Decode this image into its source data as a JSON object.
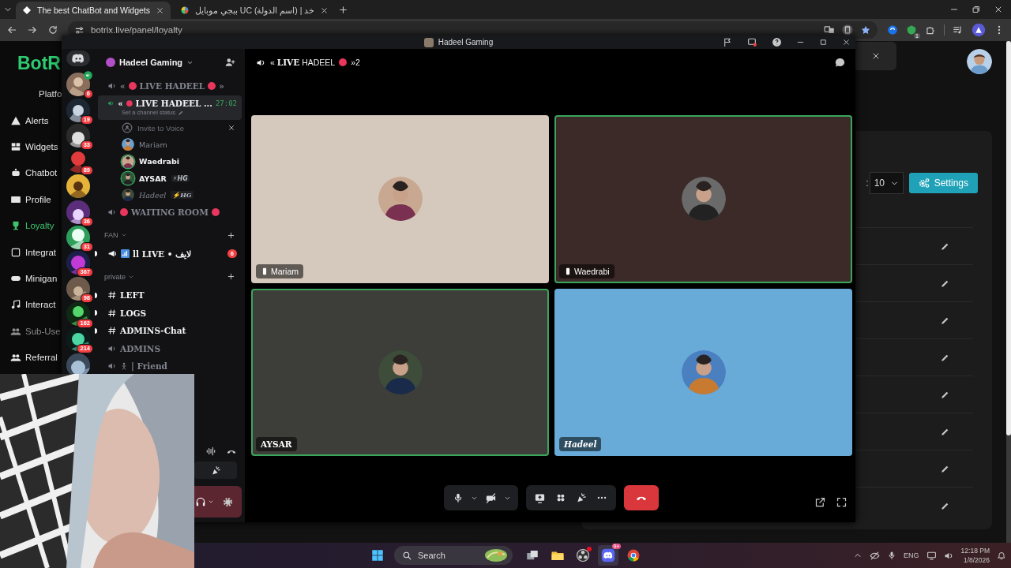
{
  "browser": {
    "tabs": [
      {
        "title": "The best ChatBot and Widgets",
        "selected": true
      },
      {
        "title": "ببجي موبايل UC (اسم الدولة) | خد",
        "selected": false
      }
    ],
    "url": "botrix.live/panel/loyalty",
    "extension_badge": "1"
  },
  "site": {
    "logo": "BotR",
    "section": "Platfo",
    "nav": [
      {
        "label": "Alerts",
        "selected": false,
        "disabled": false
      },
      {
        "label": "Widgets",
        "selected": false,
        "disabled": false
      },
      {
        "label": "Chatbot",
        "selected": false,
        "disabled": false
      },
      {
        "label": "Profile",
        "selected": false,
        "disabled": false
      },
      {
        "label": "Loyalty",
        "selected": true,
        "disabled": false
      },
      {
        "label": "Integrat",
        "selected": false,
        "disabled": false
      },
      {
        "label": "Minigan",
        "selected": false,
        "disabled": false
      },
      {
        "label": "Interact",
        "selected": false,
        "disabled": false
      },
      {
        "label": "Sub-Use",
        "selected": false,
        "disabled": true
      },
      {
        "label": "Referral",
        "selected": false,
        "disabled": false
      }
    ],
    "per_page_label": ":",
    "per_page": "10",
    "settings": "Settings",
    "rows": [
      {
        "editable": true
      },
      {
        "editable": true
      },
      {
        "editable": true
      },
      {
        "editable": true
      },
      {
        "editable": true
      },
      {
        "editable": true
      },
      {
        "editable": true
      },
      {
        "editable": true
      }
    ]
  },
  "discord": {
    "window_title": "Hadeel Gaming",
    "servers": [
      {
        "badge": "6",
        "in_voice": true
      },
      {
        "badge": "19",
        "in_voice": false
      },
      {
        "badge": "33",
        "in_voice": false
      },
      {
        "badge": "89",
        "in_voice": false
      },
      {
        "in_voice": false
      },
      {
        "badge": "36",
        "in_voice": false
      },
      {
        "badge": "31",
        "in_voice": false
      },
      {
        "badge": "367",
        "in_voice": false
      },
      {
        "badge": "98",
        "in_voice": false
      },
      {
        "badge": "162",
        "in_voice": false
      },
      {
        "badge": "214",
        "in_voice": false
      },
      {
        "in_voice": false
      }
    ],
    "server_name": "Hadeel Gaming",
    "channels": [
      {
        "kind": "voice",
        "parts": [
          {
            "kind": "text",
            "text": "«"
          },
          {
            "kind": "dot"
          },
          {
            "kind": "text",
            "text": "LIVE HADEEL"
          },
          {
            "kind": "dot"
          },
          {
            "kind": "text",
            "text": "»"
          }
        ],
        "selected": false,
        "connected": false
      },
      {
        "kind": "voice",
        "parts": [
          {
            "kind": "text",
            "text": "«"
          },
          {
            "kind": "dot"
          },
          {
            "kind": "text",
            "text": "LIVE HADEEL ..."
          }
        ],
        "selected": true,
        "connected": true,
        "timer": "27:02",
        "status": "Set a channel status"
      },
      {
        "kind": "invite",
        "label": "Invite to Voice"
      },
      {
        "kind": "member",
        "name": "Mariam",
        "speaking": false
      },
      {
        "kind": "member",
        "name": "Waedrabi",
        "speaking": true
      },
      {
        "kind": "member",
        "name": "AYSAR",
        "tag": "⚡HG",
        "speaking": true
      },
      {
        "kind": "member",
        "name": "Hadeel",
        "tag": "⚡HG",
        "speaking": false,
        "script": true
      },
      {
        "kind": "voice",
        "parts": [
          {
            "kind": "dot"
          },
          {
            "kind": "text",
            "text": "WAITING ROOM"
          },
          {
            "kind": "dot"
          }
        ],
        "selected": false,
        "connected": false
      },
      {
        "kind": "category",
        "label": "FAN"
      },
      {
        "kind": "stage",
        "label": "ll LIVE • لايف",
        "unread": true,
        "badge": "6"
      },
      {
        "kind": "category",
        "label": "private"
      },
      {
        "kind": "text",
        "label": "LEFT",
        "unread": true
      },
      {
        "kind": "text",
        "label": "LOGS",
        "unread": true
      },
      {
        "kind": "text",
        "label": "ADMINS-Chat",
        "unread": true
      },
      {
        "kind": "voice",
        "parts": [
          {
            "kind": "text",
            "text": "ADMINS"
          }
        ],
        "selected": false,
        "connected": false
      },
      {
        "kind": "voice",
        "parts": [
          {
            "kind": "figure"
          },
          {
            "kind": "text",
            "text": "| Friend"
          }
        ],
        "selected": false,
        "connected": false
      }
    ],
    "call": {
      "title": "« **LIVE** HADEEL",
      "title_end": "»2",
      "tiles": [
        {
          "name": "Mariam",
          "mobile": true,
          "speaking": false,
          "color": "#d5c8bd"
        },
        {
          "name": "Waedrabi",
          "mobile": true,
          "speaking": true,
          "color": "#3b2a28"
        },
        {
          "name": "AYSAR",
          "mobile": false,
          "speaking": true,
          "color": "#3d3e39"
        },
        {
          "name": "Hadeel",
          "mobile": false,
          "speaking": false,
          "script": true,
          "color": "#68aad8"
        }
      ]
    }
  },
  "taskbar": {
    "search": "Search",
    "discord_badge": "9+",
    "lang": "ENG",
    "time": "12:18 PM",
    "date": "1/8/2026"
  }
}
